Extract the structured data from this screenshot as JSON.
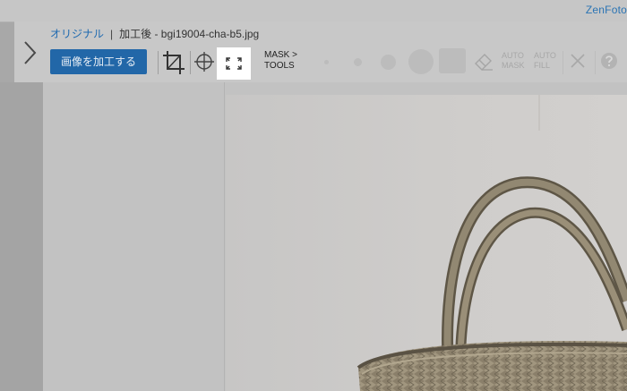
{
  "app": {
    "brand": "ZenFoto"
  },
  "breadcrumb": {
    "original_label": "オリジナル",
    "separator": "|",
    "processed_label": "加工後 - bgi19004-cha-b5.jpg"
  },
  "toolbar": {
    "process_button": "画像を加工する",
    "mask_tools_line1": "MASK >",
    "mask_tools_line2": "TOOLS",
    "auto_mask_line1": "AUTO",
    "auto_mask_line2": "MASK",
    "auto_fill_line1": "AUTO",
    "auto_fill_line2": "FILL"
  },
  "icons": [
    "chevron-right-icon",
    "crop-icon",
    "crosshair-icon",
    "fit-screen-icon",
    "brush-size-icon",
    "eraser-icon",
    "close-icon",
    "help-icon"
  ],
  "colors": {
    "accent": "#2267a8",
    "brand": "#2a74b4",
    "link": "#1f6ab0"
  }
}
